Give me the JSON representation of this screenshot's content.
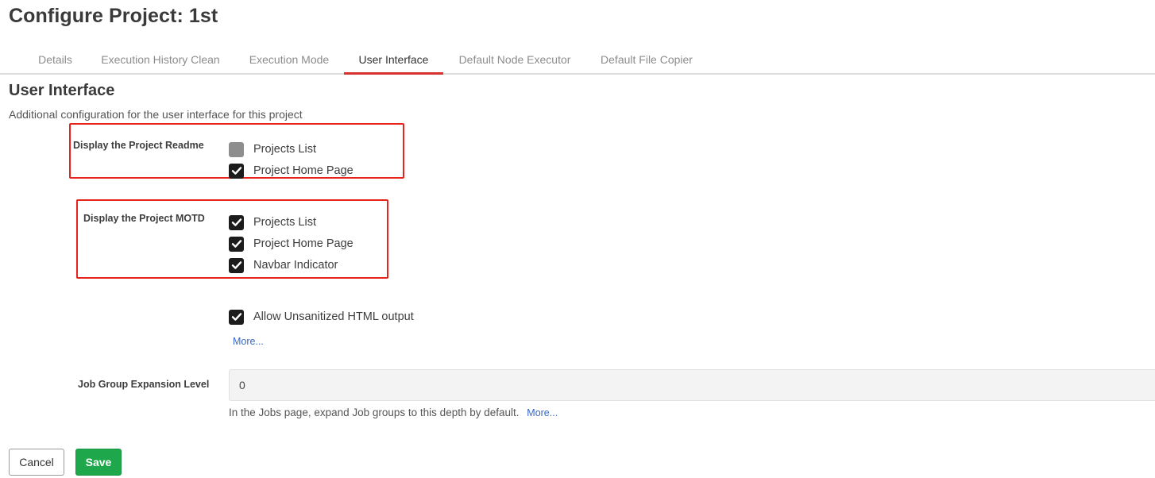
{
  "page": {
    "title": "Configure Project: 1st"
  },
  "tabs": [
    {
      "label": "Details",
      "active": false
    },
    {
      "label": "Execution History Clean",
      "active": false
    },
    {
      "label": "Execution Mode",
      "active": false
    },
    {
      "label": "User Interface",
      "active": true
    },
    {
      "label": "Default Node Executor",
      "active": false
    },
    {
      "label": "Default File Copier",
      "active": false
    }
  ],
  "section": {
    "title": "User Interface",
    "description": "Additional configuration for the user interface for this project"
  },
  "readme": {
    "label": "Display the Project Readme",
    "options": [
      {
        "label": "Projects List",
        "checked": false
      },
      {
        "label": "Project Home Page",
        "checked": true
      }
    ]
  },
  "motd": {
    "label": "Display the Project MOTD",
    "options": [
      {
        "label": "Projects List",
        "checked": true
      },
      {
        "label": "Project Home Page",
        "checked": true
      },
      {
        "label": "Navbar Indicator",
        "checked": true
      }
    ]
  },
  "unsanitized": {
    "label": "Allow Unsanitized HTML output",
    "checked": true,
    "more": "More..."
  },
  "job_group": {
    "label": "Job Group Expansion Level",
    "value": "0",
    "help": "In the Jobs page, expand Job groups to this depth by default.",
    "more": "More..."
  },
  "buttons": {
    "cancel": "Cancel",
    "save": "Save"
  },
  "colors": {
    "accent_tab": "#d6322f",
    "highlight": "#e8231c",
    "save_bg": "#1ea84b",
    "link": "#3a67c4"
  },
  "icons": {
    "checkbox_checked": "checkmark-icon"
  }
}
